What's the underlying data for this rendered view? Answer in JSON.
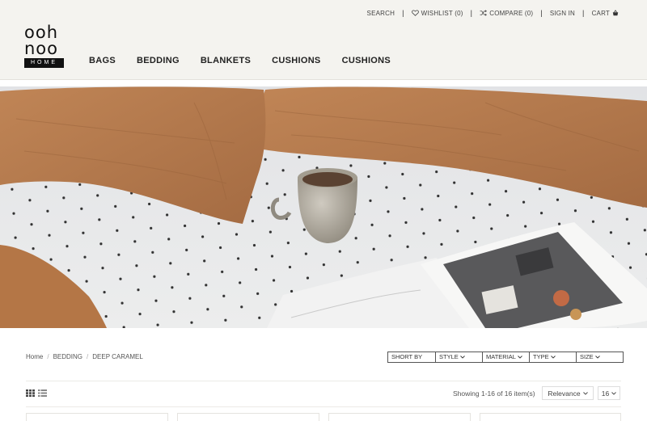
{
  "brand": {
    "logo_top": "ooh",
    "logo_mid": "noo",
    "logo_bar": "HOME"
  },
  "top_links": {
    "search": "SEARCH",
    "wishlist": "WISHLIST (0)",
    "compare": "COMPARE (0)",
    "signin": "SIGN IN",
    "cart": "CART",
    "separator": "|"
  },
  "nav": [
    "BAGS",
    "BEDDING",
    "BLANKETS",
    "CUSHIONS",
    "CUSHIONS"
  ],
  "breadcrumb": {
    "items": [
      "Home",
      "BEDDING",
      "DEEP CARAMEL"
    ],
    "separator": "/"
  },
  "filters": [
    "SHORT BY",
    "STYLE",
    "MATERIAL",
    "TYPE",
    "SIZE"
  ],
  "listing": {
    "showing": "Showing 1-16 of 16 item(s)",
    "sort_value": "Relevance",
    "per_page": "16"
  },
  "icons": {
    "wishlist": "heart-icon",
    "compare": "shuffle-icon",
    "cart": "basket-icon",
    "grid": "grid-icon",
    "list": "list-icon",
    "caret": "chevron-down-icon"
  },
  "colors": {
    "header_bg": "#f4f3ef",
    "pillow": "#b77a4e",
    "sheet": "#e8e9ec",
    "text": "#222222"
  }
}
